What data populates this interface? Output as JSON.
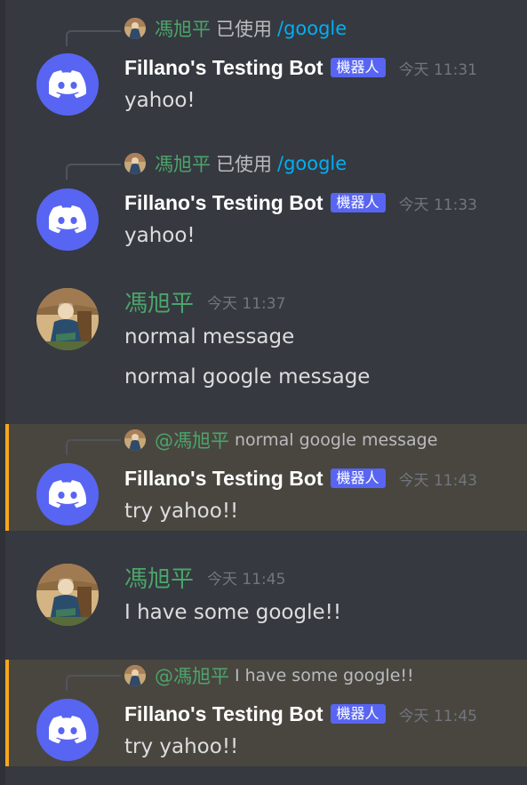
{
  "messages": [
    {
      "reply": {
        "name": "馮旭平",
        "used": "已使用",
        "command": "/google"
      },
      "author": "Fillano's Testing Bot",
      "tag": "機器人",
      "time": "今天 11:31",
      "lines": [
        "yahoo!"
      ]
    },
    {
      "reply": {
        "name": "馮旭平",
        "used": "已使用",
        "command": "/google"
      },
      "author": "Fillano's Testing Bot",
      "tag": "機器人",
      "time": "今天 11:33",
      "lines": [
        "yahoo!"
      ]
    },
    {
      "author": "馮旭平",
      "time": "今天 11:37",
      "lines": [
        "normal message",
        "normal google message"
      ]
    },
    {
      "reply": {
        "name": "@馮旭平",
        "text": "normal google message"
      },
      "author": "Fillano's Testing Bot",
      "tag": "機器人",
      "time": "今天 11:43",
      "lines": [
        "try yahoo!!"
      ]
    },
    {
      "author": "馮旭平",
      "time": "今天 11:45",
      "lines": [
        "I have some google!!"
      ]
    },
    {
      "reply": {
        "name": "@馮旭平",
        "text": "I have some google!!"
      },
      "author": "Fillano's Testing Bot",
      "tag": "機器人",
      "time": "今天 11:45",
      "lines": [
        "try yahoo!!"
      ]
    }
  ],
  "colors": {
    "background": "#36393f",
    "bot_avatar": "#5865f2",
    "user_name": "#4ba56b",
    "command": "#00aff4",
    "mention_highlight": "#494640",
    "mention_bar": "#faa61a"
  },
  "icons": {
    "bot_avatar": "discord-logo-icon",
    "user_avatar": "portrait-avatar"
  }
}
